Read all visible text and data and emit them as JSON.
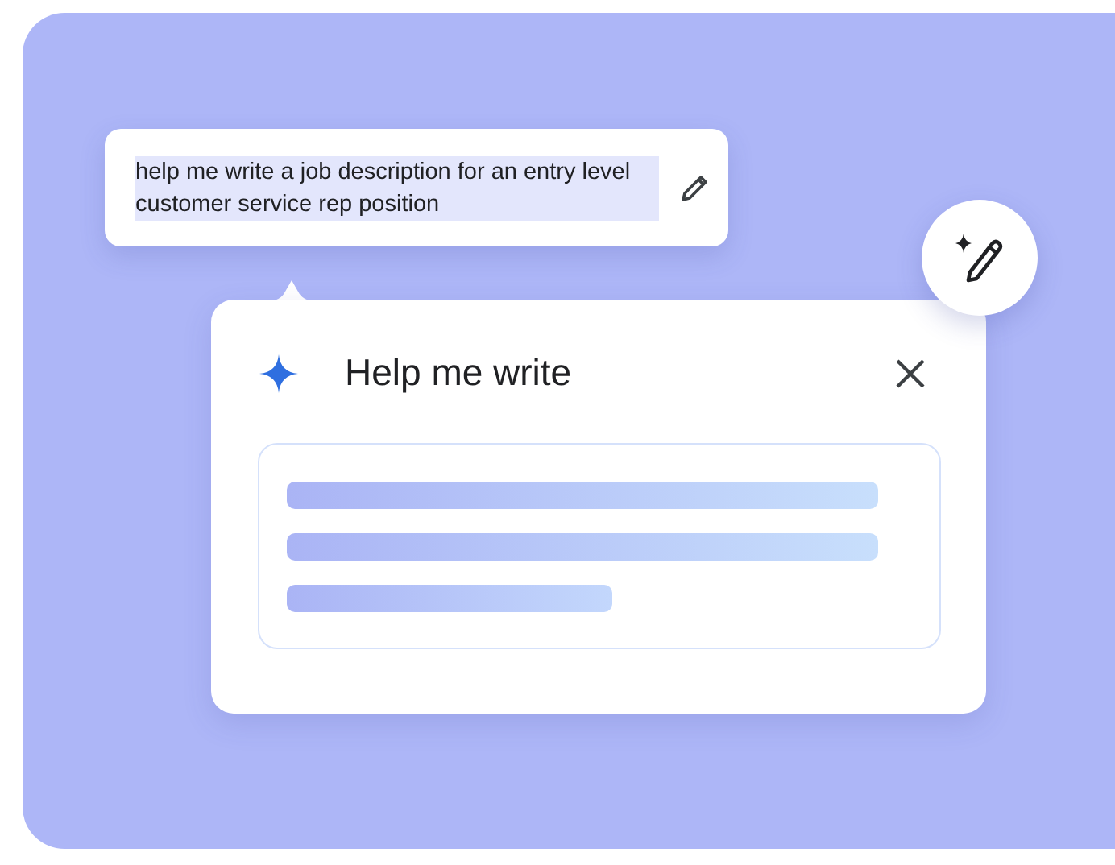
{
  "prompt": {
    "text": "help me write a job description for an entry level customer service rep position",
    "highlighted": true
  },
  "dialog": {
    "title": "Help me write",
    "skeleton_lines": [
      {
        "kind": "full"
      },
      {
        "kind": "full"
      },
      {
        "kind": "short"
      }
    ]
  }
}
